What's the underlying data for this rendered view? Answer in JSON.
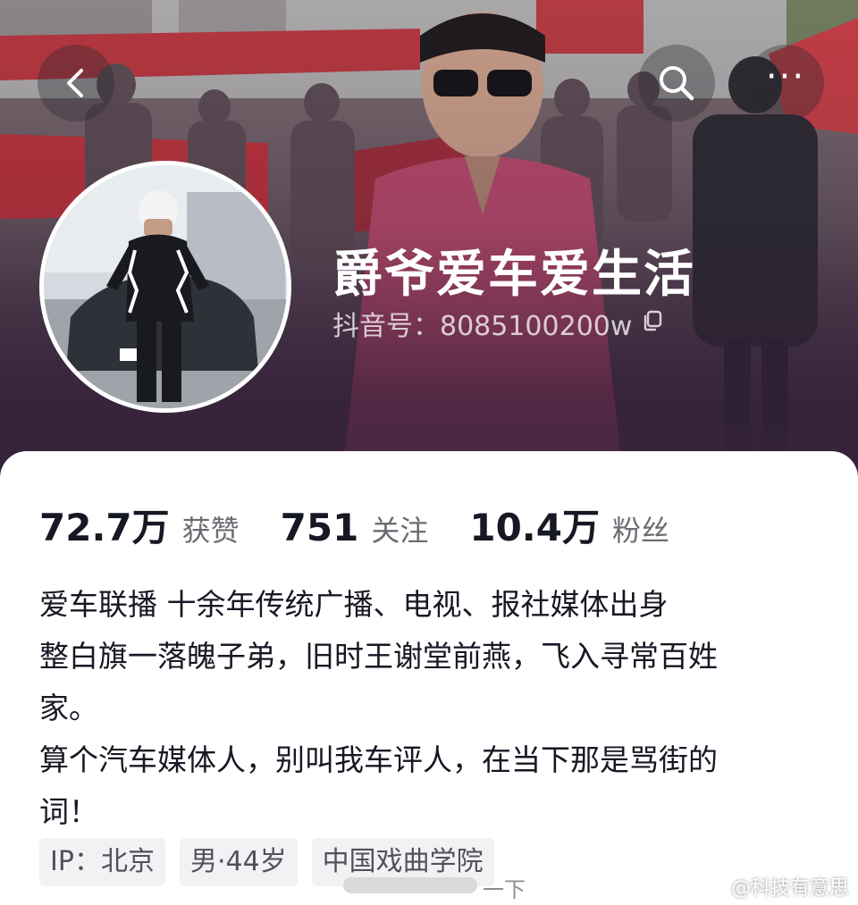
{
  "header": {
    "back_icon": "chevron-left-icon",
    "search_icon": "search-icon",
    "more_icon": "more-horizontal-icon",
    "more_label": "···"
  },
  "profile": {
    "nickname": "爵爷爱车爱生活",
    "douyin_id": "抖音号：8085100200w",
    "copy_icon": "copy-icon"
  },
  "stats": [
    {
      "value": "72.7万",
      "label": "获赞"
    },
    {
      "value": "751",
      "label": "关注"
    },
    {
      "value": "10.4万",
      "label": "粉丝"
    }
  ],
  "bio": [
    "爱车联播 十余年传统广播、电视、报社媒体出身",
    "整白旗一落魄子弟，旧时王谢堂前燕，飞入寻常百姓",
    "家。",
    "算个汽车媒体人，别叫我车评人，在当下那是骂街的",
    "词！"
  ],
  "tags": [
    "IP：北京",
    "男·44岁",
    "中国戏曲学院"
  ],
  "overlay": {
    "partial_text": "一下",
    "watermark": "@科技有意思"
  },
  "colors": {
    "text_primary": "#161823",
    "text_secondary": "#6b6d74",
    "tag_bg": "#f2f2f4",
    "banner_tint": "#4e3c4c"
  }
}
